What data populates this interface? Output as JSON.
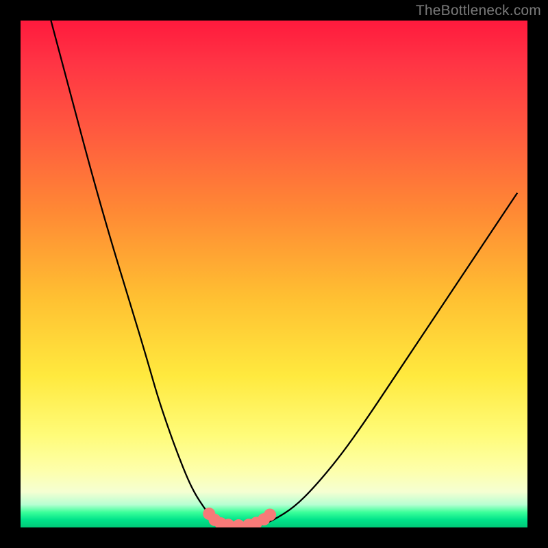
{
  "attribution": "TheBottleneck.com",
  "chart_data": {
    "type": "line",
    "title": "",
    "xlabel": "",
    "ylabel": "",
    "ylim": [
      0,
      100
    ],
    "xlim": [
      0,
      100
    ],
    "series": [
      {
        "name": "left-curve",
        "x": [
          6,
          10,
          14,
          18,
          22,
          25,
          27,
          29,
          31,
          33,
          34.5,
          36,
          37.3,
          38.3,
          39.3
        ],
        "values": [
          100,
          85,
          70,
          56,
          43,
          33,
          26,
          20,
          14.5,
          9.5,
          6.5,
          4.2,
          2.4,
          1.2,
          0.5
        ]
      },
      {
        "name": "valley-floor",
        "x": [
          39.3,
          42,
          45,
          47.5
        ],
        "values": [
          0.5,
          0.2,
          0.2,
          0.5
        ]
      },
      {
        "name": "right-curve",
        "x": [
          47.5,
          50,
          54,
          58,
          63,
          68,
          74,
          80,
          86,
          92,
          98
        ],
        "values": [
          0.5,
          1.5,
          4,
          8,
          14,
          21,
          30,
          39,
          48,
          57,
          66
        ]
      }
    ],
    "markers": {
      "name": "valley-markers",
      "color": "#f77a78",
      "points": [
        {
          "x": 37.2,
          "y": 2.7
        },
        {
          "x": 38.3,
          "y": 1.5
        },
        {
          "x": 39.5,
          "y": 0.8
        },
        {
          "x": 41.0,
          "y": 0.5
        },
        {
          "x": 43.0,
          "y": 0.4
        },
        {
          "x": 45.0,
          "y": 0.5
        },
        {
          "x": 46.5,
          "y": 0.9
        },
        {
          "x": 48.0,
          "y": 1.6
        },
        {
          "x": 49.2,
          "y": 2.5
        }
      ]
    },
    "color_scheme": {
      "top": "#ff1a3d",
      "mid_upper": "#ff8a34",
      "mid": "#ffe93e",
      "mid_lower": "#fdffad",
      "bottom": "#00c877",
      "curve_stroke": "#000000",
      "marker_fill": "#f77a78"
    }
  }
}
